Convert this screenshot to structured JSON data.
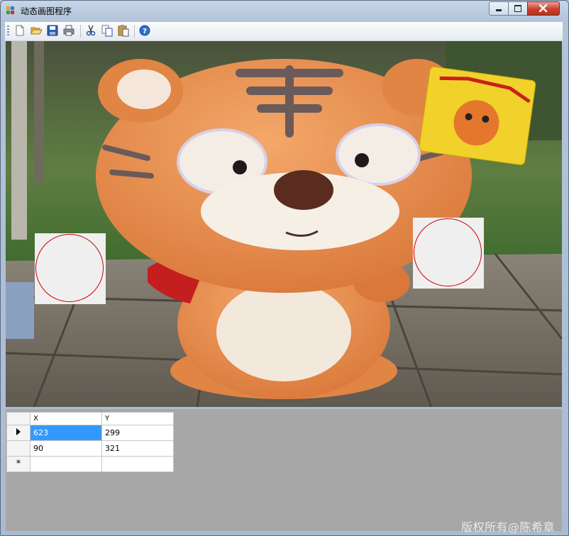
{
  "window": {
    "title": "动态画图程序"
  },
  "colors": {
    "selection": "#3399ff",
    "circle_outline": "#cc0000",
    "grid_background": "#a7a7a7"
  },
  "toolbar": {
    "items": [
      {
        "name": "new-icon"
      },
      {
        "name": "open-icon"
      },
      {
        "name": "save-icon"
      },
      {
        "name": "print-icon"
      },
      {
        "name": "cut-icon"
      },
      {
        "name": "copy-icon"
      },
      {
        "name": "paste-icon"
      },
      {
        "name": "help-icon"
      }
    ]
  },
  "grid": {
    "columns": [
      "X",
      "Y"
    ],
    "rows": [
      {
        "x": "623",
        "y": "299",
        "selected": true
      },
      {
        "x": "90",
        "y": "321",
        "selected": false
      }
    ],
    "new_row_marker": "*"
  },
  "watermark": "版权所有@陈希章"
}
